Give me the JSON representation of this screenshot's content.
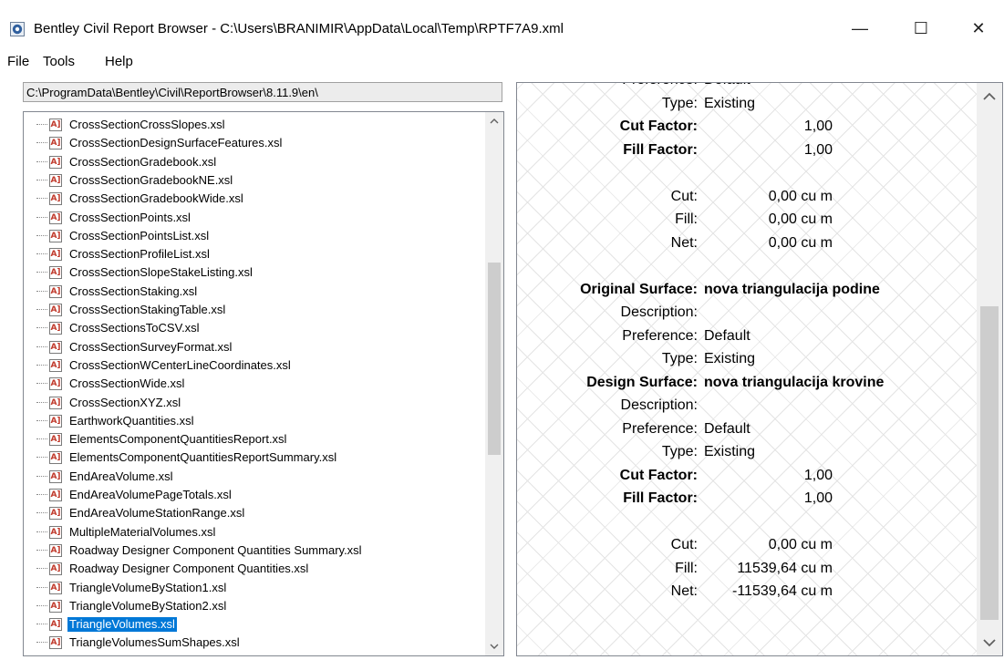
{
  "window": {
    "title": "Bentley Civil Report Browser - C:\\Users\\BRANIMIR\\AppData\\Local\\Temp\\RPTF7A9.xml",
    "minimize": "—",
    "maximize": "☐",
    "close": "✕"
  },
  "menu": [
    "File",
    "Tools",
    "Help"
  ],
  "path": "C:\\ProgramData\\Bentley\\Civil\\ReportBrowser\\8.11.9\\en\\",
  "tree_icon_text": "A]",
  "files": [
    "CrossSectionCrossSlopes.xsl",
    "CrossSectionDesignSurfaceFeatures.xsl",
    "CrossSectionGradebook.xsl",
    "CrossSectionGradebookNE.xsl",
    "CrossSectionGradebookWide.xsl",
    "CrossSectionPoints.xsl",
    "CrossSectionPointsList.xsl",
    "CrossSectionProfileList.xsl",
    "CrossSectionSlopeStakeListing.xsl",
    "CrossSectionStaking.xsl",
    "CrossSectionStakingTable.xsl",
    "CrossSectionsToCSV.xsl",
    "CrossSectionSurveyFormat.xsl",
    "CrossSectionWCenterLineCoordinates.xsl",
    "CrossSectionWide.xsl",
    "CrossSectionXYZ.xsl",
    "EarthworkQuantities.xsl",
    "ElementsComponentQuantitiesReport.xsl",
    "ElementsComponentQuantitiesReportSummary.xsl",
    "EndAreaVolume.xsl",
    "EndAreaVolumePageTotals.xsl",
    "EndAreaVolumeStationRange.xsl",
    "MultipleMaterialVolumes.xsl",
    "Roadway Designer Component Quantities Summary.xsl",
    "Roadway Designer Component Quantities.xsl",
    "TriangleVolumeByStation1.xsl",
    "TriangleVolumeByStation2.xsl",
    "TriangleVolumes.xsl",
    "TriangleVolumesSumShapes.xsl"
  ],
  "selected_file": "TriangleVolumes.xsl",
  "report_rows": [
    {
      "label": "Preference:",
      "value": "Default",
      "bold": false,
      "num": false
    },
    {
      "label": "Type:",
      "value": "Existing",
      "bold": false,
      "num": false
    },
    {
      "label": "Cut Factor:",
      "value": "1,00",
      "bold": true,
      "num": true,
      "plain_value": true
    },
    {
      "label": "Fill Factor:",
      "value": "1,00",
      "bold": true,
      "num": true,
      "plain_value": true
    },
    {
      "label": "",
      "value": "",
      "bold": false,
      "num": false
    },
    {
      "label": "Cut:",
      "value": "0,00 cu m",
      "bold": false,
      "num": true
    },
    {
      "label": "Fill:",
      "value": "0,00 cu m",
      "bold": false,
      "num": true
    },
    {
      "label": "Net:",
      "value": "0,00 cu m",
      "bold": false,
      "num": true
    },
    {
      "label": "",
      "value": "",
      "bold": false,
      "num": false
    },
    {
      "label": "Original Surface:",
      "value": "nova triangulacija podine",
      "bold": true,
      "num": false
    },
    {
      "label": "Description:",
      "value": "",
      "bold": false,
      "num": false
    },
    {
      "label": "Preference:",
      "value": "Default",
      "bold": false,
      "num": false
    },
    {
      "label": "Type:",
      "value": "Existing",
      "bold": false,
      "num": false
    },
    {
      "label": "Design Surface:",
      "value": "nova triangulacija krovine",
      "bold": true,
      "num": false
    },
    {
      "label": "Description:",
      "value": "",
      "bold": false,
      "num": false
    },
    {
      "label": "Preference:",
      "value": "Default",
      "bold": false,
      "num": false
    },
    {
      "label": "Type:",
      "value": "Existing",
      "bold": false,
      "num": false
    },
    {
      "label": "Cut Factor:",
      "value": "1,00",
      "bold": true,
      "num": true,
      "plain_value": true
    },
    {
      "label": "Fill Factor:",
      "value": "1,00",
      "bold": true,
      "num": true,
      "plain_value": true
    },
    {
      "label": "",
      "value": "",
      "bold": false,
      "num": false
    },
    {
      "label": "Cut:",
      "value": "0,00 cu m",
      "bold": false,
      "num": true
    },
    {
      "label": "Fill:",
      "value": "11539,64 cu m",
      "bold": false,
      "num": true
    },
    {
      "label": "Net:",
      "value": "-11539,64 cu m",
      "bold": false,
      "num": true
    }
  ],
  "scroll": {
    "left_thumb_start": 0.26,
    "left_thumb_size": 0.38,
    "right_thumb_start": 0.38,
    "right_thumb_size": 0.6
  }
}
